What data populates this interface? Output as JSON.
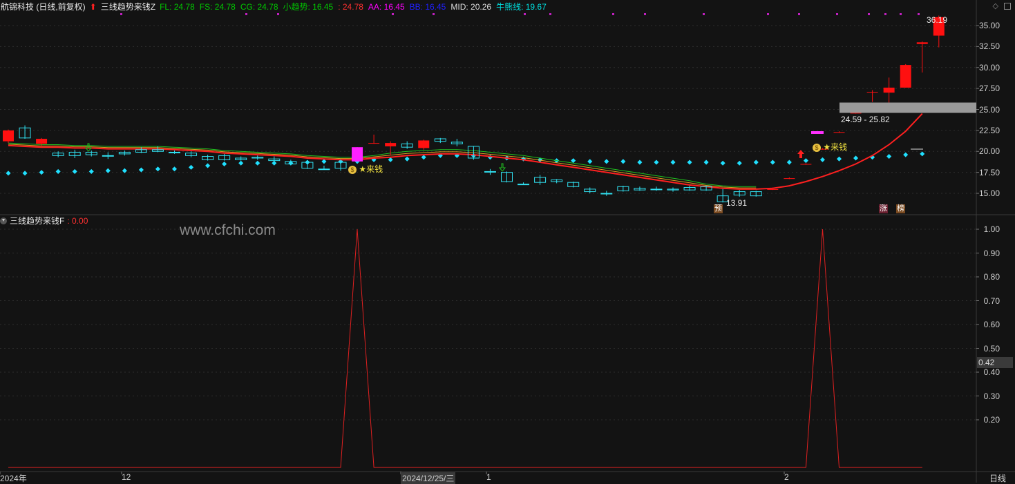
{
  "header": {
    "stock_name": "航锦科技 (日线,前复权)",
    "indicator_name": "三线趋势来钱Z",
    "items": [
      {
        "label": "FL: 24.78",
        "color": "#00c800"
      },
      {
        "label": "FS: 24.78",
        "color": "#00c800"
      },
      {
        "label": "CG: 24.78",
        "color": "#00c800"
      },
      {
        "label": "小趋势: 16.45",
        "color": "#00c800"
      },
      {
        "label": ": 24.78",
        "color": "#ff3030"
      },
      {
        "label": "AA: 16.45",
        "color": "#ff00ff"
      },
      {
        "label": "BB: 16.45",
        "color": "#2020ff"
      },
      {
        "label": "MID: 20.26",
        "color": "#dddddd"
      },
      {
        "label": "牛熊线: 19.67",
        "color": "#00e0e0"
      }
    ]
  },
  "sub_header": {
    "indicator_name": "三线趋势来钱F",
    "value": ": 0.00"
  },
  "watermark": "www.cfchi.com",
  "upper_axis": [
    "35.00",
    "32.50",
    "30.00",
    "27.50",
    "25.00",
    "22.50",
    "20.00",
    "17.50",
    "15.00"
  ],
  "lower_axis": [
    "1.00",
    "0.90",
    "0.80",
    "0.70",
    "0.60",
    "0.50",
    "0.40",
    "0.30",
    "0.20"
  ],
  "lower_current_value": "0.42",
  "x_labels": [
    "2024年",
    "12",
    "2024/12/25/三",
    "1",
    "2"
  ],
  "period_label": "日线",
  "annotations": {
    "high": "36.19",
    "low": "13.91",
    "range": "24.59 - 25.82",
    "signal1": "★来钱",
    "signal2": "★来钱",
    "tag_yu": "预",
    "tag_zhang": "涨",
    "tag_bang": "榜"
  },
  "chart_data": [
    {
      "type": "candlestick",
      "title": "三线趋势来钱Z",
      "ylim": [
        13.0,
        37.5
      ],
      "candles": [
        {
          "o": 21.2,
          "c": 22.5,
          "h": 22.6,
          "l": 21.0,
          "up": true
        },
        {
          "o": 21.6,
          "c": 22.8,
          "h": 23.1,
          "l": 21.5,
          "up": false
        },
        {
          "o": 20.9,
          "c": 21.5,
          "h": 21.6,
          "l": 20.7,
          "up": true
        },
        {
          "o": 19.5,
          "c": 19.8,
          "h": 20.0,
          "l": 19.3,
          "up": false
        },
        {
          "o": 19.5,
          "c": 19.9,
          "h": 20.2,
          "l": 19.2,
          "up": false
        },
        {
          "o": 19.6,
          "c": 19.9,
          "h": 20.1,
          "l": 19.4,
          "up": false
        },
        {
          "o": 19.5,
          "c": 19.5,
          "h": 19.9,
          "l": 19.1,
          "up": false
        },
        {
          "o": 19.7,
          "c": 19.9,
          "h": 20.1,
          "l": 19.5,
          "up": false
        },
        {
          "o": 19.9,
          "c": 20.2,
          "h": 20.5,
          "l": 19.8,
          "up": false
        },
        {
          "o": 20.0,
          "c": 20.2,
          "h": 20.6,
          "l": 19.9,
          "up": false
        },
        {
          "o": 19.9,
          "c": 19.9,
          "h": 20.1,
          "l": 19.7,
          "up": false
        },
        {
          "o": 19.5,
          "c": 19.8,
          "h": 20.0,
          "l": 19.3,
          "up": false
        },
        {
          "o": 19.0,
          "c": 19.4,
          "h": 19.6,
          "l": 18.9,
          "up": false
        },
        {
          "o": 19.0,
          "c": 19.5,
          "h": 19.7,
          "l": 18.9,
          "up": false
        },
        {
          "o": 19.0,
          "c": 19.2,
          "h": 19.4,
          "l": 18.9,
          "up": false
        },
        {
          "o": 19.2,
          "c": 19.3,
          "h": 19.5,
          "l": 19.0,
          "up": false
        },
        {
          "o": 18.9,
          "c": 19.1,
          "h": 19.4,
          "l": 18.8,
          "up": false
        },
        {
          "o": 18.5,
          "c": 18.8,
          "h": 19.0,
          "l": 18.4,
          "up": false
        },
        {
          "o": 18.0,
          "c": 18.7,
          "h": 18.9,
          "l": 17.9,
          "up": false
        },
        {
          "o": 17.9,
          "c": 17.9,
          "h": 18.3,
          "l": 17.8,
          "up": false
        },
        {
          "o": 18.0,
          "c": 18.7,
          "h": 19.0,
          "l": 17.7,
          "up": false
        },
        {
          "o": 18.8,
          "c": 20.5,
          "h": 20.5,
          "l": 18.8,
          "up": true,
          "magenta": true
        },
        {
          "o": 21.0,
          "c": 21.0,
          "h": 22.0,
          "l": 20.9,
          "up": true
        },
        {
          "o": 20.6,
          "c": 21.0,
          "h": 21.2,
          "l": 19.5,
          "up": true
        },
        {
          "o": 20.5,
          "c": 20.9,
          "h": 21.2,
          "l": 20.3,
          "up": false
        },
        {
          "o": 20.4,
          "c": 21.3,
          "h": 21.4,
          "l": 20.2,
          "up": true
        },
        {
          "o": 21.2,
          "c": 21.5,
          "h": 21.6,
          "l": 21.0,
          "up": false
        },
        {
          "o": 20.9,
          "c": 21.1,
          "h": 21.5,
          "l": 20.6,
          "up": false
        },
        {
          "o": 20.6,
          "c": 19.2,
          "h": 20.6,
          "l": 19.0,
          "up": false
        },
        {
          "o": 17.6,
          "c": 17.6,
          "h": 17.9,
          "l": 17.2,
          "up": false
        },
        {
          "o": 16.4,
          "c": 17.5,
          "h": 17.6,
          "l": 16.3,
          "up": false
        },
        {
          "o": 16.1,
          "c": 16.1,
          "h": 16.3,
          "l": 16.0,
          "up": false
        },
        {
          "o": 16.3,
          "c": 16.9,
          "h": 17.2,
          "l": 16.0,
          "up": false
        },
        {
          "o": 16.4,
          "c": 16.6,
          "h": 16.7,
          "l": 16.2,
          "up": false
        },
        {
          "o": 15.8,
          "c": 16.3,
          "h": 16.4,
          "l": 15.7,
          "up": false
        },
        {
          "o": 15.2,
          "c": 15.5,
          "h": 15.7,
          "l": 15.0,
          "up": false
        },
        {
          "o": 15.0,
          "c": 15.0,
          "h": 15.3,
          "l": 14.7,
          "up": false
        },
        {
          "o": 15.3,
          "c": 15.8,
          "h": 15.9,
          "l": 15.2,
          "up": false
        },
        {
          "o": 15.4,
          "c": 15.6,
          "h": 15.8,
          "l": 15.3,
          "up": false
        },
        {
          "o": 15.5,
          "c": 15.5,
          "h": 15.8,
          "l": 15.3,
          "up": false
        },
        {
          "o": 15.4,
          "c": 15.5,
          "h": 15.7,
          "l": 15.2,
          "up": false
        },
        {
          "o": 15.4,
          "c": 15.7,
          "h": 15.9,
          "l": 15.3,
          "up": false
        },
        {
          "o": 15.4,
          "c": 15.8,
          "h": 15.9,
          "l": 15.3,
          "up": false
        },
        {
          "o": 14.0,
          "c": 14.7,
          "h": 15.5,
          "l": 13.91,
          "up": false
        },
        {
          "o": 14.8,
          "c": 15.2,
          "h": 15.4,
          "l": 14.6,
          "up": false
        },
        {
          "o": 14.7,
          "c": 15.2,
          "h": 15.3,
          "l": 14.6,
          "up": false
        },
        {
          "o": 15.5,
          "c": 15.5,
          "h": 15.7,
          "l": 15.4,
          "up": true
        },
        {
          "o": 16.8,
          "c": 16.8,
          "h": 16.9,
          "l": 16.7,
          "up": true
        },
        {
          "o": 18.5,
          "c": 18.5,
          "h": 18.6,
          "l": 18.4,
          "up": true
        },
        {
          "o": 20.3,
          "c": 20.3,
          "h": 20.4,
          "l": 20.2,
          "up": true
        },
        {
          "o": 22.3,
          "c": 22.3,
          "h": 22.4,
          "l": 22.2,
          "up": true
        },
        {
          "o": 24.6,
          "c": 24.6,
          "h": 24.7,
          "l": 24.5,
          "up": true
        },
        {
          "o": 27.1,
          "c": 27.1,
          "h": 27.3,
          "l": 25.9,
          "up": true
        },
        {
          "o": 27.0,
          "c": 27.6,
          "h": 28.8,
          "l": 25.8,
          "up": true
        },
        {
          "o": 27.6,
          "c": 30.3,
          "h": 30.4,
          "l": 27.6,
          "up": true
        },
        {
          "o": 32.8,
          "c": 33.0,
          "h": 33.1,
          "l": 29.4,
          "up": true
        },
        {
          "o": 33.8,
          "c": 36.0,
          "h": 36.19,
          "l": 32.4,
          "up": true
        }
      ]
    },
    {
      "type": "line",
      "title": "三线趋势来钱F",
      "ylim": [
        0.0,
        1.05
      ],
      "x_range": [
        0,
        56
      ],
      "series": [
        {
          "values_at": [
            [
              0,
              0
            ],
            [
              20,
              0
            ],
            [
              21,
              1
            ],
            [
              22,
              0
            ],
            [
              48,
              0
            ],
            [
              49,
              1
            ],
            [
              50,
              0
            ],
            [
              55,
              0
            ]
          ]
        }
      ]
    }
  ]
}
